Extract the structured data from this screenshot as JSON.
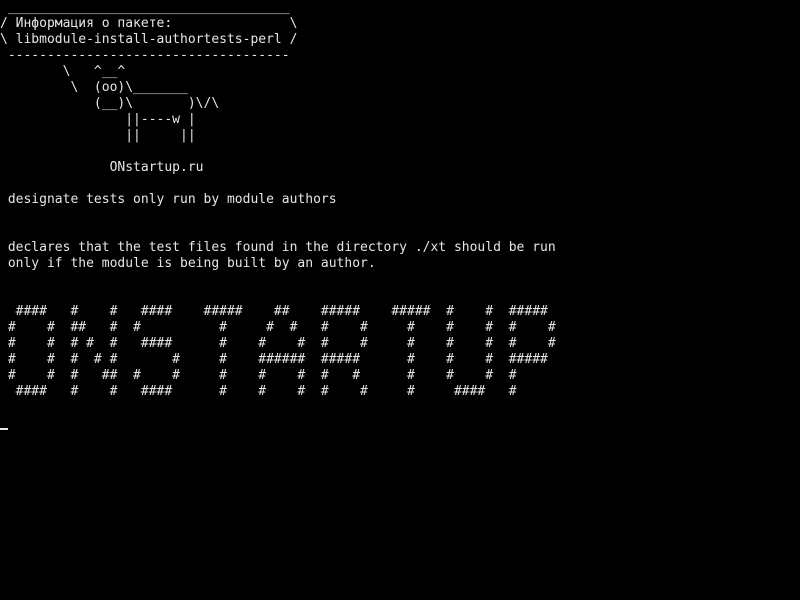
{
  "terminal": {
    "speech_bubble": [
      " ____________________________________",
      "/ Информация о пакете:               \\",
      "\\ libmodule-install-authortests-perl /",
      " ------------------------------------"
    ],
    "cow": [
      "        \\   ^__^",
      "         \\  (oo)\\_______",
      "            (__)\\       )\\/\\",
      "                ||----w |",
      "                ||     ||"
    ],
    "site": "              ONstartup.ru",
    "summary": " designate tests only run by module authors",
    "description": [
      " declares that the test files found in the directory ./xt should be run",
      " only if the module is being built by an author."
    ],
    "banner": [
      "  ####   #    #   ####    #####    ##    #####    #####  #    #  #####",
      " #    #  ##   #  #          #     #  #   #    #     #    #    #  #    #",
      " #    #  # #  #   ####      #    #    #  #    #     #    #    #  #    #",
      " #    #  #  # #       #     #    ######  #####      #    #    #  #####",
      " #    #  #   ##  #    #     #    #    #  #   #      #    #    #  #",
      "  ####   #    #   ####      #    #    #  #    #     #     ####   #"
    ],
    "text_color": "#e6e6e6",
    "background_color": "#000000"
  }
}
